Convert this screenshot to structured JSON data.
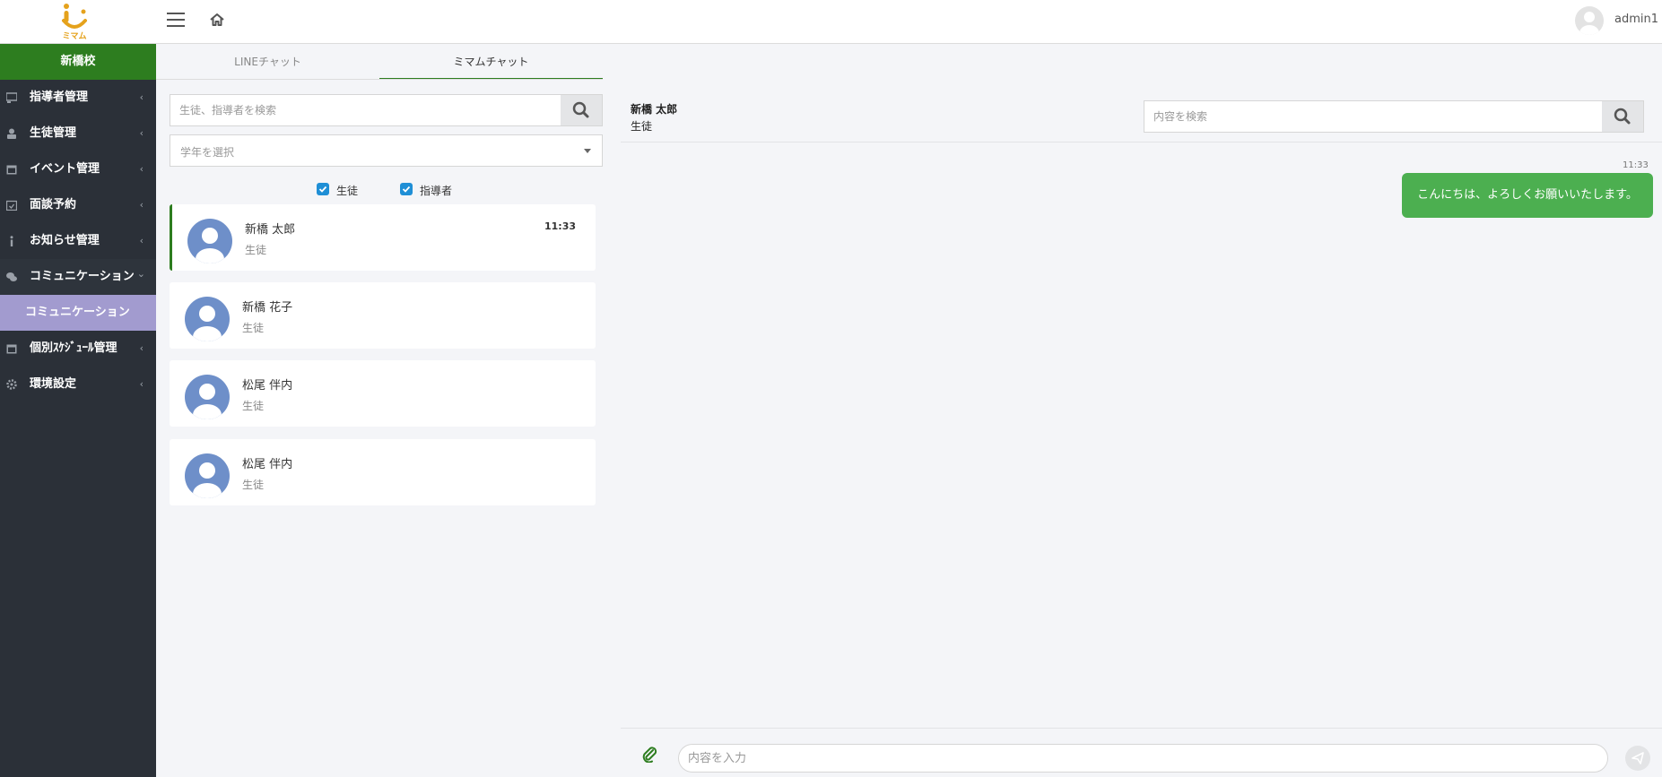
{
  "header": {
    "logo_text": "ミマム",
    "username": "admin1"
  },
  "sidebar": {
    "school": "新橋校",
    "items": [
      {
        "label": "指導者管理"
      },
      {
        "label": "生徒管理"
      },
      {
        "label": "イベント管理"
      },
      {
        "label": "面談予約"
      },
      {
        "label": "お知らせ管理"
      },
      {
        "label": "コミュニケーション"
      },
      {
        "label": "個別ｽｹｼﾞｭｰﾙ管理"
      },
      {
        "label": "環境設定"
      }
    ],
    "sub_item": "コミュニケーション",
    "chevron_closed": "‹",
    "chevron_open": "⌄"
  },
  "tabs": [
    {
      "label": "LINEチャット"
    },
    {
      "label": "ミマムチャット"
    }
  ],
  "contact_search": {
    "placeholder": "生徒、指導者を検索"
  },
  "grade_select": {
    "value": "学年を選択"
  },
  "filters": [
    {
      "label": "生徒",
      "checked": true
    },
    {
      "label": "指導者",
      "checked": true
    }
  ],
  "contacts": [
    {
      "name": "新橋 太郎",
      "role": "生徒",
      "time": "11:33"
    },
    {
      "name": "新橋 花子",
      "role": "生徒",
      "time": ""
    },
    {
      "name": "松尾 伴内",
      "role": "生徒",
      "time": ""
    },
    {
      "name": "松尾 伴内",
      "role": "生徒",
      "time": ""
    }
  ],
  "chat": {
    "name": "新橋 太郎",
    "role": "生徒",
    "search_placeholder": "内容を検索",
    "messages": [
      {
        "time": "11:33",
        "text": "こんにちは、よろしくお願いいたします。"
      }
    ],
    "input_placeholder": "内容を入力"
  },
  "colors": {
    "brand_green": "#2d7d1f",
    "sidebar_bg": "#2b3038",
    "active_sub": "#a29bcf",
    "bubble": "#4caf50",
    "checkbox": "#1f8fd6",
    "logo": "#e5a21c"
  }
}
